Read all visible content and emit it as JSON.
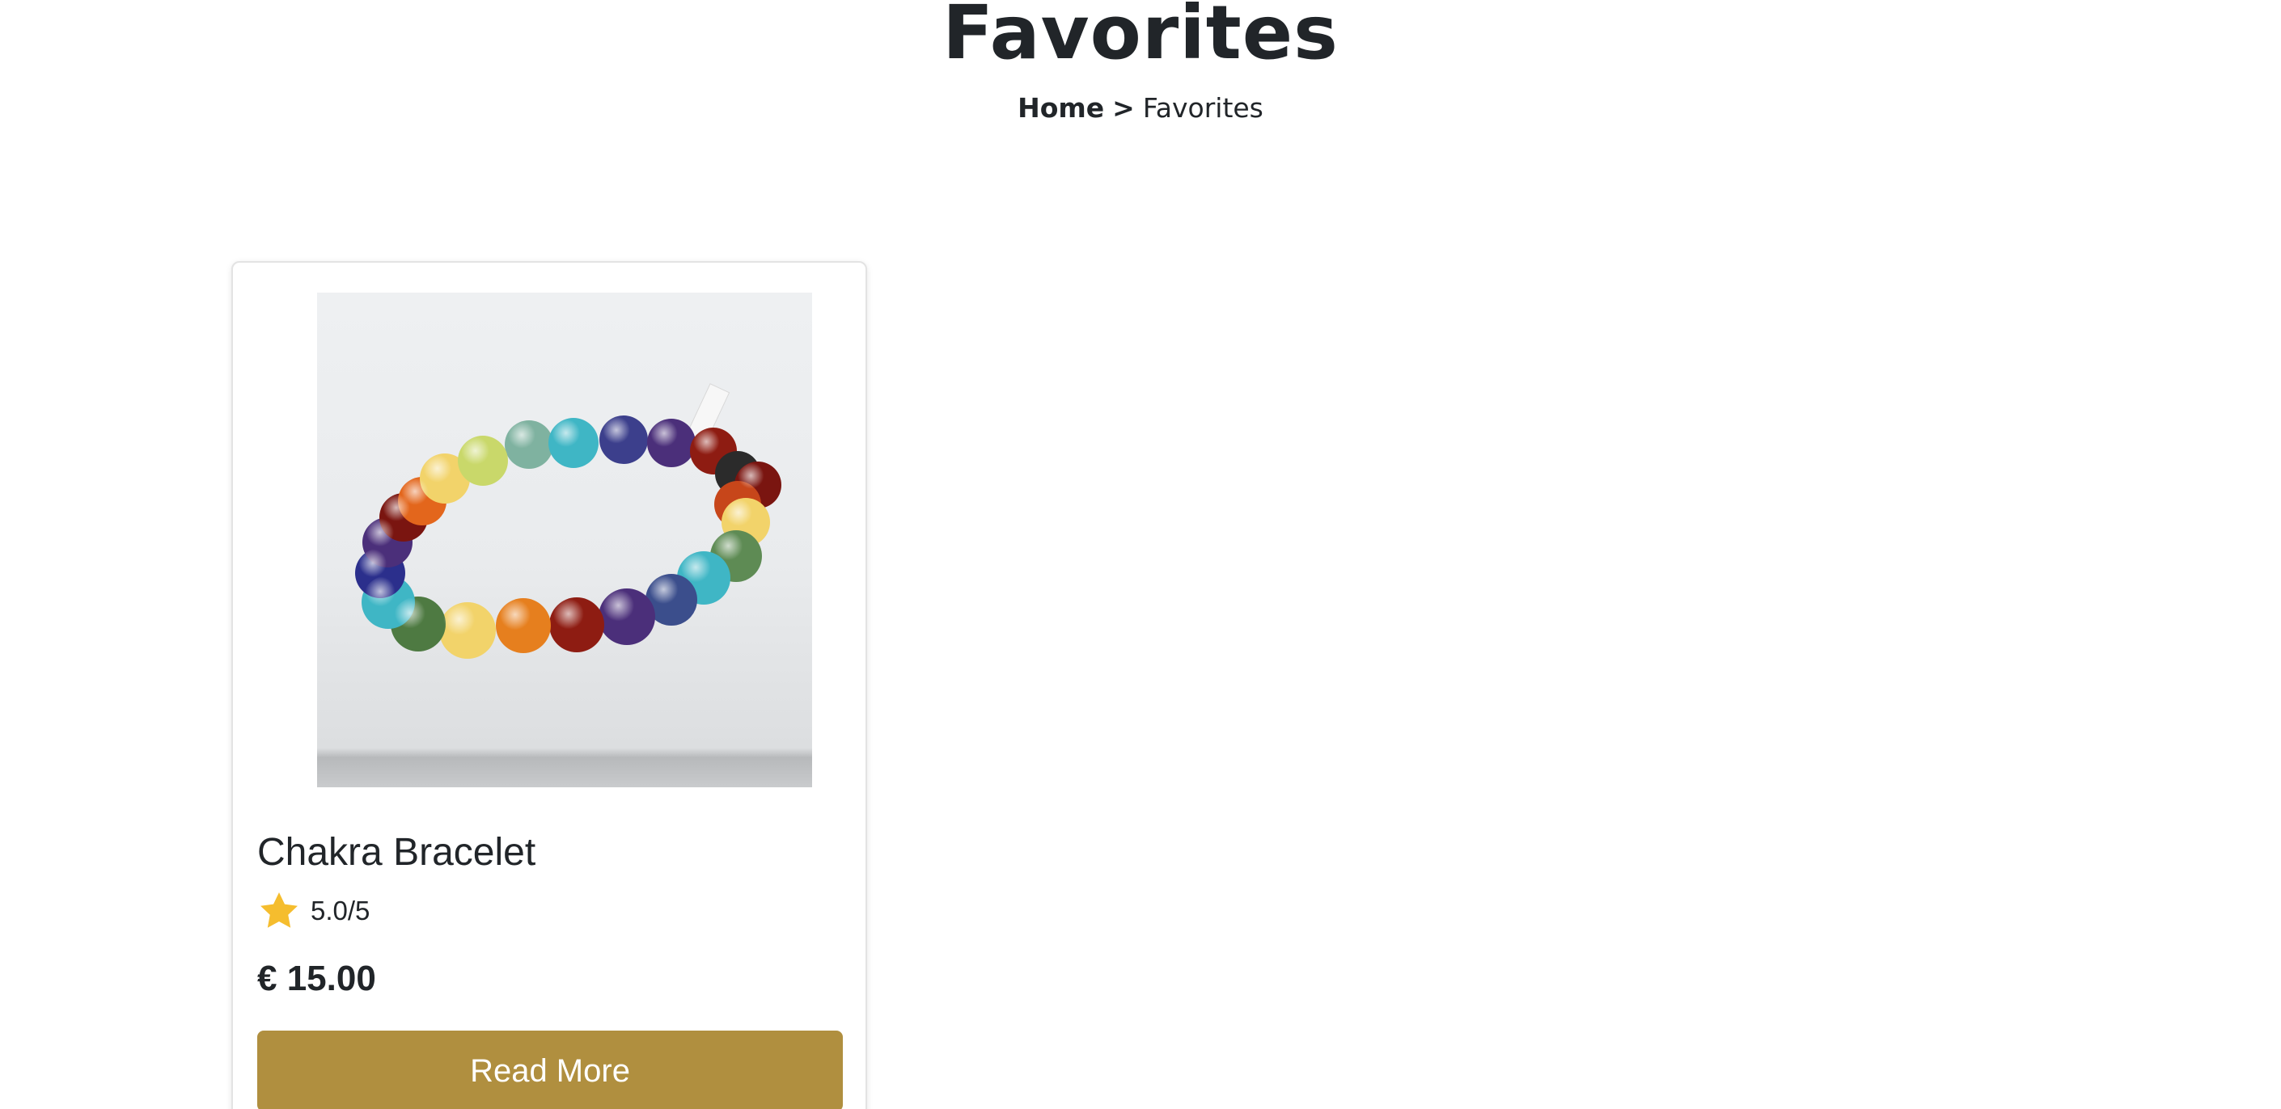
{
  "header": {
    "title": "Favorites",
    "breadcrumb": {
      "home_label": "Home",
      "separator": ">",
      "current_label": "Favorites"
    }
  },
  "favorites": [
    {
      "name": "Chakra Bracelet",
      "rating": "5.0/5",
      "price": "€ 15.00",
      "button_label": "Read More",
      "image_icon": "bracelet-photo"
    }
  ],
  "colors": {
    "button": "#b08f3f",
    "star": "#f5bd2e",
    "text": "#212529"
  }
}
